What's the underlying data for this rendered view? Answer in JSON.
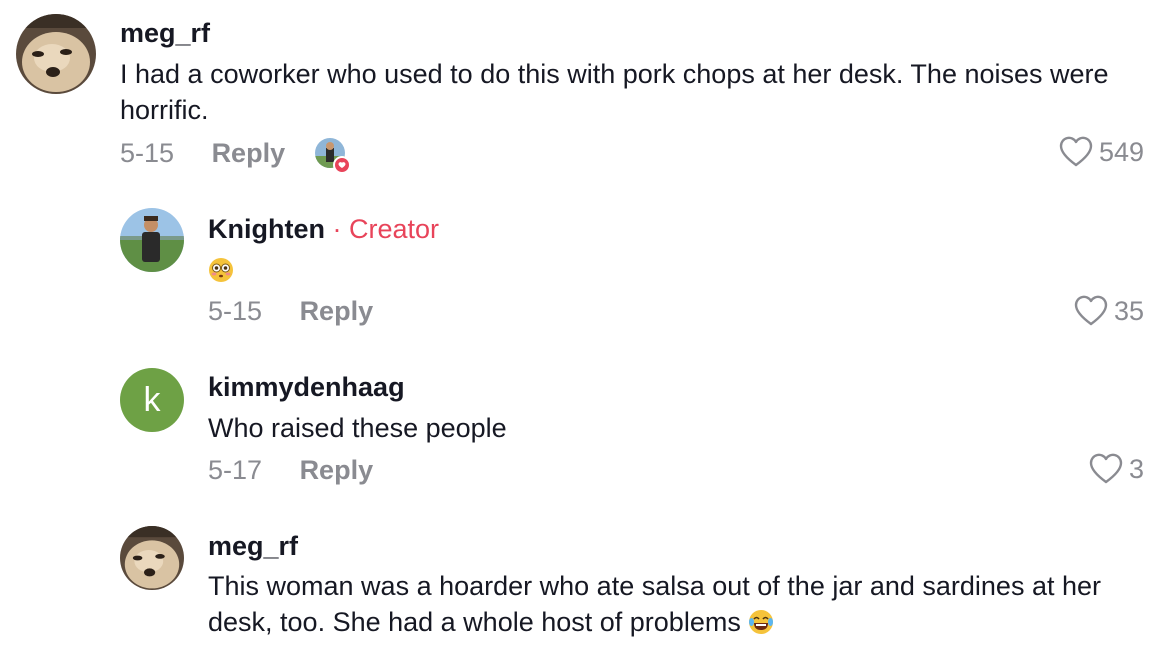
{
  "comments": [
    {
      "username": "meg_rf",
      "text": "I had a coworker who used to do this with pork chops at her desk. The noises were horrific.",
      "date": "5-15",
      "reply_label": "Reply",
      "likes": "549"
    },
    {
      "username": "Knighten",
      "creator_sep": "·",
      "creator_label": "Creator",
      "text": "😳",
      "date": "5-15",
      "reply_label": "Reply",
      "likes": "35"
    },
    {
      "username": "kimmydenhaag",
      "avatar_letter": "k",
      "text": "Who raised these people",
      "date": "5-17",
      "reply_label": "Reply",
      "likes": "3"
    },
    {
      "username": "meg_rf",
      "text": "This woman was a hoarder who ate salsa out of the jar and sardines at her desk, too. She had a whole host of problems",
      "text_emoji": "😂"
    }
  ],
  "colors": {
    "creator": "#e8445a",
    "meta": "#8a8b91",
    "avatar_k": "#6ea145"
  }
}
